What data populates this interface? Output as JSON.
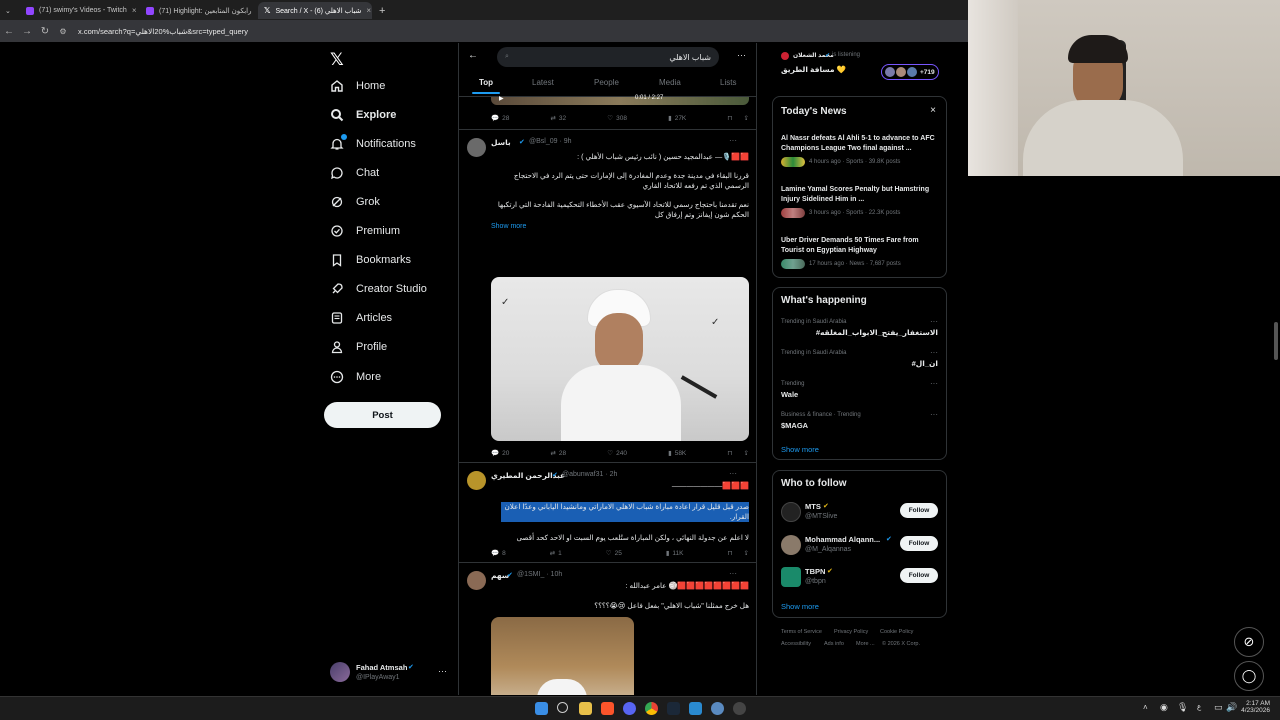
{
  "browser": {
    "tabs": [
      {
        "title": "(71) swimy's Videos - Twitch"
      },
      {
        "title": "(71) Highlight: رابكون المتابعين"
      },
      {
        "title": "Search / X - شباب الاهلي (6)"
      }
    ],
    "url": "x.com/search?q=شباب%20الاهلي&src=typed_query"
  },
  "nav": {
    "items": [
      {
        "label": "Home",
        "icon": "home-icon"
      },
      {
        "label": "Explore",
        "icon": "search-icon"
      },
      {
        "label": "Notifications",
        "icon": "bell-icon"
      },
      {
        "label": "Chat",
        "icon": "chat-icon"
      },
      {
        "label": "Grok",
        "icon": "grok-icon"
      },
      {
        "label": "Premium",
        "icon": "premium-icon"
      },
      {
        "label": "Bookmarks",
        "icon": "bookmark-icon"
      },
      {
        "label": "Creator Studio",
        "icon": "rocket-icon"
      },
      {
        "label": "Articles",
        "icon": "article-icon"
      },
      {
        "label": "Profile",
        "icon": "person-icon"
      },
      {
        "label": "More",
        "icon": "more-icon"
      }
    ],
    "post_label": "Post",
    "account": {
      "name": "Fahad Atmsah",
      "handle": "@IPlayAway1"
    }
  },
  "search": {
    "query": "شباب الاهلي",
    "tabs": [
      "Top",
      "Latest",
      "People",
      "Media",
      "Lists"
    ],
    "video_time": "0:01 / 2:27"
  },
  "tweets": [
    {
      "actions": {
        "replies": "28",
        "reposts": "32",
        "likes": "308",
        "views": "27K"
      }
    },
    {
      "name": "باسل",
      "handle": "@Bsl_09 · 9h",
      "line1": "🟥🟥🎙️— عبدالمجيد حسين ( نائب رئيس شباب الأهلي ) :",
      "para1": "قررنا البقاء في مدينة جدة وعدم المغادرة إلى الإمارات حتى يتم الرد في الاحتجاج الرسمي الذي تم رفعه للاتحاد القاري",
      "para2": "نعم تقدمنا باحتجاج رسمي للاتحاد الآسيوي عقب الأخطاء التحكيمية الفادحة التي ارتكبها الحكم شون إيفانز وتم إرفاق كل",
      "show_more": "Show more",
      "actions": {
        "replies": "20",
        "reposts": "28",
        "likes": "240",
        "views": "58K"
      }
    },
    {
      "name": "عبدالرحمن المطيري",
      "handle": "@abunwaf31 · 2h",
      "line1": "🟥🟥🟥———————",
      "para1": "صدر قبل قليل قرار اعادة مباراة شباب الاهلي الاماراتي ومانشيدا الياباني وعدًا اعلان القرار.",
      "para2": "لا اعلم عن جدولة النهائي ، ولكن المباراة ستُلعب يوم السبت او الاحد كحد أقصى",
      "actions": {
        "replies": "8",
        "reposts": "1",
        "likes": "25",
        "views": "11K"
      }
    },
    {
      "name": "سهم",
      "handle": "@1SMI_ · 10h",
      "line1": "🟥🟥🟥🟥🟥🟥🟥🟥🏐 عامر عبدالله :",
      "para1": "هل خرج ممثلنا \"شباب الاهلي\" بفعل فاعل 😢😭؟؟؟؟"
    }
  ],
  "spaces": {
    "host": "محمد الشعلان",
    "status": "is listening",
    "title": "مسافة الطريق 💛",
    "count": "+719"
  },
  "news": {
    "title": "Today's News",
    "items": [
      {
        "headline": "Al Nassr defeats Al Ahli 5-1 to advance to AFC Champions League Two final against ...",
        "meta": "4 hours ago · Sports · 39.8K posts"
      },
      {
        "headline": "Lamine Yamal Scores Penalty but Hamstring Injury Sidelined Him in ...",
        "meta": "3 hours ago · Sports · 22.3K posts"
      },
      {
        "headline": "Uber Driver Demands 50 Times Fare from Tourist on Egyptian Highway",
        "meta": "17 hours ago · News · 7,687 posts"
      }
    ]
  },
  "happening": {
    "title": "What's happening",
    "items": [
      {
        "context": "Trending in Saudi Arabia",
        "topic": "#الاستغفار_يفتح_الابواب_المغلقه"
      },
      {
        "context": "Trending in Saudi Arabia",
        "topic": "#ان_ال"
      },
      {
        "context": "Trending",
        "topic": "Wale"
      },
      {
        "context": "Business & finance · Trending",
        "topic": "$MAGA"
      }
    ],
    "show_more": "Show more"
  },
  "who_to_follow": {
    "title": "Who to follow",
    "items": [
      {
        "name": "MTS",
        "handle": "@MTSlive",
        "follow": "Follow"
      },
      {
        "name": "Mohammad Alqann...",
        "handle": "@M_Alqannas",
        "follow": "Follow"
      },
      {
        "name": "TBPN",
        "handle": "@tbpn",
        "follow": "Follow"
      }
    ],
    "show_more": "Show more"
  },
  "footer": {
    "links": [
      "Terms of Service",
      "Privacy Policy",
      "Cookie Policy",
      "Accessibility",
      "Ads info",
      "More ...",
      "© 2026 X Corp."
    ]
  },
  "system": {
    "time": "2:17 AM",
    "date": "4/23/2026"
  },
  "colors": {
    "accent": "#1d9bf0",
    "verified": "#1d9bf0",
    "gold": "#e2b719",
    "border": "#2f3336",
    "muted": "#71767b"
  }
}
